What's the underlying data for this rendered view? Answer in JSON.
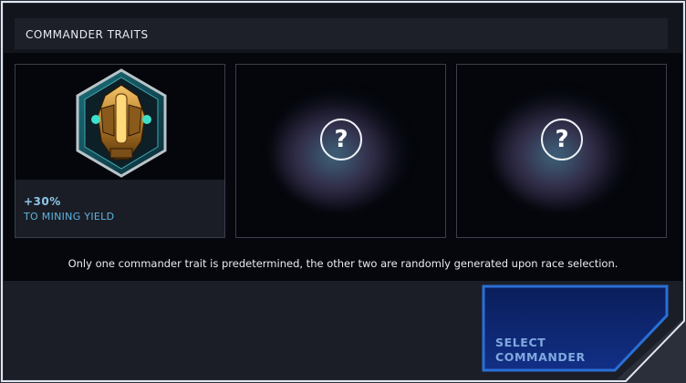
{
  "header": {
    "title": "COMMANDER TRAITS"
  },
  "traits": [
    {
      "value": "+30%",
      "description": "TO MINING YIELD",
      "icon": "mining-emblem-icon"
    },
    {
      "icon": "unknown-trait-icon",
      "glyph": "?"
    },
    {
      "icon": "unknown-trait-icon",
      "glyph": "?"
    }
  ],
  "note": "Only one commander trait is predetermined, the other two are randomly generated upon race selection.",
  "select_button": {
    "label": "SELECT COMMANDER"
  },
  "colors": {
    "accent_blue": "#2a6fd6",
    "trait_text": "#5fb3df",
    "frame": "#dfe6ee"
  }
}
